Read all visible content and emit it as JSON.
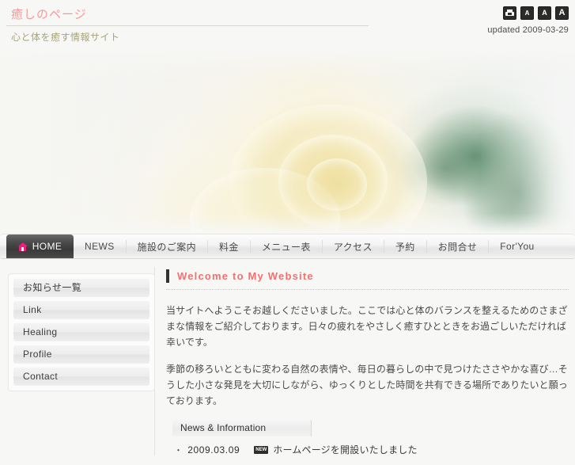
{
  "header": {
    "site_title": "癒しのページ",
    "site_subtitle": "心と体を癒す情報サイト",
    "updated_label": "updated 2009-03-29",
    "print_icon": "printer-icon",
    "text_size_small": "A",
    "text_size_medium": "A",
    "text_size_large": "A"
  },
  "hero": {
    "alt": "cream-rose-banner-photo"
  },
  "nav": {
    "items": [
      {
        "label": "HOME",
        "icon": "home-icon",
        "active": true
      },
      {
        "label": "NEWS",
        "active": false
      },
      {
        "label": "施設のご案内",
        "active": false
      },
      {
        "label": "料金",
        "active": false
      },
      {
        "label": "メニュー表",
        "active": false
      },
      {
        "label": "アクセス",
        "active": false
      },
      {
        "label": "予約",
        "active": false
      },
      {
        "label": "お問合せ",
        "active": false
      },
      {
        "label": "For'You",
        "active": false
      }
    ]
  },
  "sidebar": {
    "items": [
      {
        "label": "お知らせ一覧"
      },
      {
        "label": "Link"
      },
      {
        "label": "Healing"
      },
      {
        "label": "Profile"
      },
      {
        "label": "Contact"
      }
    ]
  },
  "main": {
    "welcome_title": "Welcome to My Website",
    "paragraph_1": "当サイトへようこそお越しくださいました。ここでは心と体のバランスを整えるためのさまざまな情報をご紹介しております。日々の疲れをやさしく癒すひとときをお過ごしいただければ幸いです。",
    "paragraph_2": "季節の移ろいとともに変わる自然の表情や、毎日の暮らしの中で見つけたささやかな喜び…そうした小さな発見を大切にしながら、ゆっくりとした時間を共有できる場所でありたいと願っております。",
    "news_heading": "News & Information",
    "news_items": [
      {
        "bullet": "・",
        "date": "2009.03.09",
        "badge": "NEW",
        "text": "ホームページを開設いたしました"
      }
    ]
  },
  "colors": {
    "accent_pink": "#f4706e",
    "title_pink": "#f49a9a",
    "subtitle_olive": "#a8a477",
    "home_icon_pink": "#ec1f7a",
    "nav_active_bg": "#3a3a3a"
  }
}
